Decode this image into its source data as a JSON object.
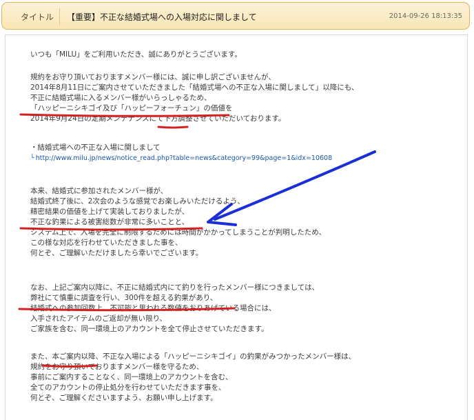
{
  "header": {
    "label": "タイトル",
    "title": "【重要】不正な結婚式場への入場対応に関しまして",
    "date": "2014-09-26 18:13:35"
  },
  "body": {
    "lines": [
      "いつも「MILU」をご利用いただき、誠にありがとうございます。",
      "規約をお守り頂いておりますメンバー様には、誠に申し訳ございませんが、",
      "2014年8月11日にご案内させていただきました「結婚式場への不正な入場に関しまして」以降にも、",
      "不正に結婚式場に入るメンバー様がいらっしゃるため、",
      "「ハッピーニシキゴイ及び「ハッピーフォーチュン」の価値を",
      "2014年9月24日の定期メンテナンスにて下方調整させていただいております。",
      "・結婚式場への不正な入場に関しまして",
      "本来、結婚式に参加されたメンバー様が、",
      "結婚式終了後に、2次会のような感覚でお楽しみいただけるよう、",
      "精密結果の価値を上げて実装しておりましたが、",
      "不正な釣果による被害総数が非常に多いことと、",
      "システム上で、入場を完全に制限するためには時間がかかってしまうことが判明したため、",
      "この様な対応を行わせていただきました事を、",
      "何とぞ、ご理解いただけましたら幸いでございます。",
      "なお、上記ご案内以降に、不正に結婚式内にて釣りを行ったメンバー様につきましては、",
      "弊社にて慎重に調査を行い、300件を超える釣果があり、",
      "結婚式への参加回数上、不可能と思われる数値をおりあげている場合には、",
      "入手されたアイテムのご返却が無い限り、",
      "ご家族を含む、同一環境上のアカウントを全て停止させていただきます。",
      "また、本ご案内以降、不正な入場による「ハッピーニシキゴイ」の釣果がみつかったメンバー様は、",
      "規約をお守り頂いておりますメンバー様を守るため、",
      "事前にご案内することなく、同一環境上のアカウントを含む、",
      "全てのアカウントの停止処分を行わせていただきます事を、",
      "何とぞ、ご理解くださいますよう、お願い申し上げます。"
    ],
    "link_prefix": "└",
    "link_url": "http://www.milu.jp/news/notice_read.php?table=news&category=99&page=1&idx=10608"
  },
  "annotations": {
    "underline_color": "#d42020",
    "arrow_color": "#1a2fd6"
  }
}
